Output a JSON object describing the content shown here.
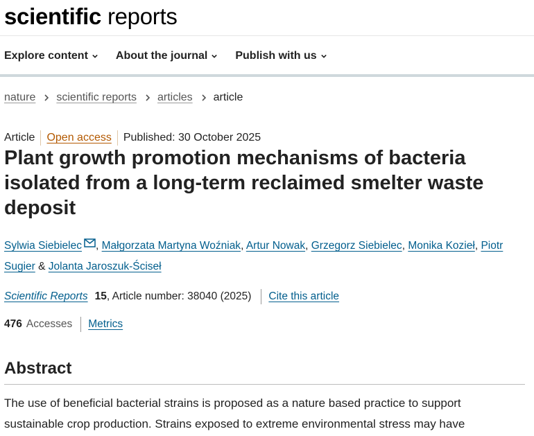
{
  "logo": {
    "bold": "scientific",
    "light": "reports"
  },
  "nav": [
    {
      "label": "Explore content"
    },
    {
      "label": "About the journal"
    },
    {
      "label": "Publish with us"
    }
  ],
  "breadcrumb": [
    "nature",
    "scientific reports",
    "articles",
    "article"
  ],
  "meta": {
    "type": "Article",
    "access": "Open access",
    "published": "Published: 30 October 2025"
  },
  "title": "Plant growth promotion mechanisms of bacteria isolated from a long-term reclaimed smelter waste deposit",
  "authors": [
    "Sylwia Siebielec",
    "Małgorzata Martyna Woźniak",
    "Artur Nowak",
    "Grzegorz Siebielec",
    "Monika Kozieł",
    "Piotr Sugier",
    "Jolanta Jaroszuk-Ściseł"
  ],
  "author_sep": {
    "comma": ", ",
    "amp": " & "
  },
  "citation": {
    "journal": "Scientific Reports",
    "volume": "15",
    "article_number": ", Article number: 38040 (2025)",
    "cite_link": "Cite this article"
  },
  "stats": {
    "accesses": "476",
    "accesses_label": "Accesses",
    "metrics_link": "Metrics"
  },
  "abstract": {
    "heading": "Abstract",
    "text": "The use of beneficial bacterial strains is proposed as a nature based practice to support sustainable crop production. Strains exposed to extreme environmental stress may have"
  },
  "colors": {
    "link": "#025e8d",
    "open_access": "#b35900",
    "text": "#222222"
  },
  "icons": {
    "nav_chevron": "chevron-down-icon",
    "breadcrumb_sep": "chevron-right-icon",
    "author_contact": "envelope-icon"
  }
}
